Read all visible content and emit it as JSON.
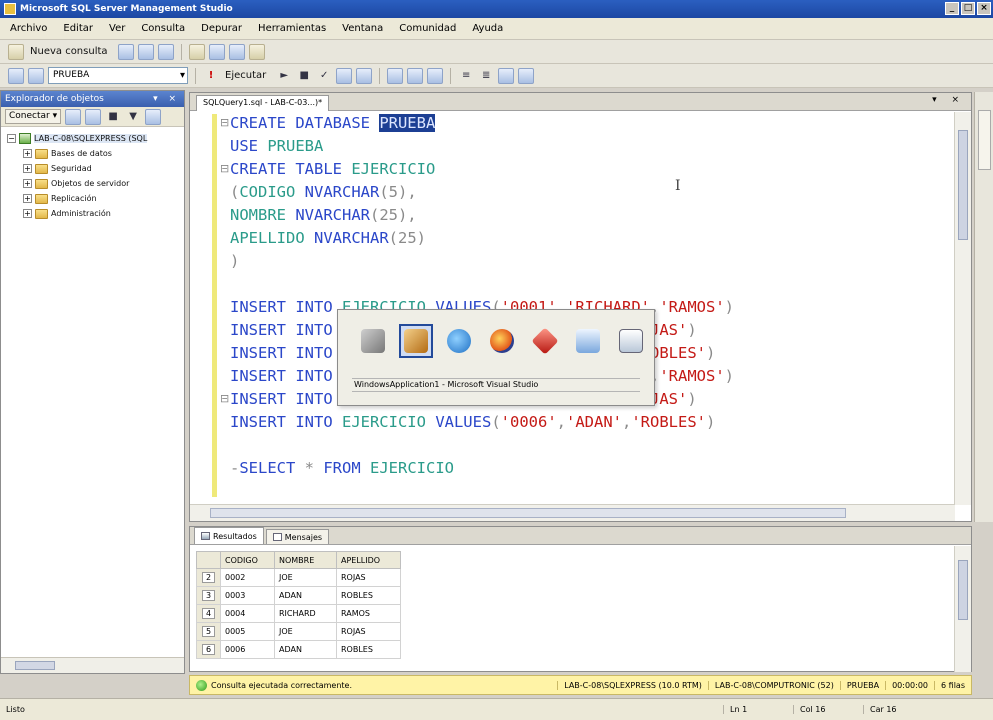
{
  "window": {
    "title": "Microsoft SQL Server Management Studio"
  },
  "menu": [
    "Archivo",
    "Editar",
    "Ver",
    "Consulta",
    "Depurar",
    "Herramientas",
    "Ventana",
    "Comunidad",
    "Ayuda"
  ],
  "toolbar": {
    "new_query_label": "Nueva consulta",
    "database": "PRUEBA",
    "execute_label": "Ejecutar"
  },
  "object_explorer": {
    "title": "Explorador de objetos",
    "connect_label": "Conectar ▾",
    "server": "LAB-C-08\\SQLEXPRESS (SQL",
    "nodes": [
      "Bases de datos",
      "Seguridad",
      "Objetos de servidor",
      "Replicación",
      "Administración"
    ]
  },
  "editor": {
    "tab_title": "SQLQuery1.sql - LAB-C-03...)*"
  },
  "switcher": {
    "caption": "WindowsApplication1 - Microsoft Visual Studio"
  },
  "results": {
    "tabs": [
      "Resultados",
      "Mensajes"
    ],
    "columns": [
      "CODIGO",
      "NOMBRE",
      "APELLIDO"
    ],
    "rows": [
      [
        "2",
        "0002",
        "JOE",
        "ROJAS"
      ],
      [
        "3",
        "0003",
        "ADAN",
        "ROBLES"
      ],
      [
        "4",
        "0004",
        "RICHARD",
        "RAMOS"
      ],
      [
        "5",
        "0005",
        "JOE",
        "ROJAS"
      ],
      [
        "6",
        "0006",
        "ADAN",
        "ROBLES"
      ]
    ]
  },
  "status": {
    "message": "Consulta ejecutada correctamente.",
    "server": "LAB-C-08\\SQLEXPRESS (10.0 RTM)",
    "user": "LAB-C-08\\COMPUTRONIC (52)",
    "db": "PRUEBA",
    "time": "00:00:00",
    "rows": "6 filas",
    "ready": "Listo",
    "ln": "Ln 1",
    "col": "Col 16",
    "car": "Car 16"
  }
}
